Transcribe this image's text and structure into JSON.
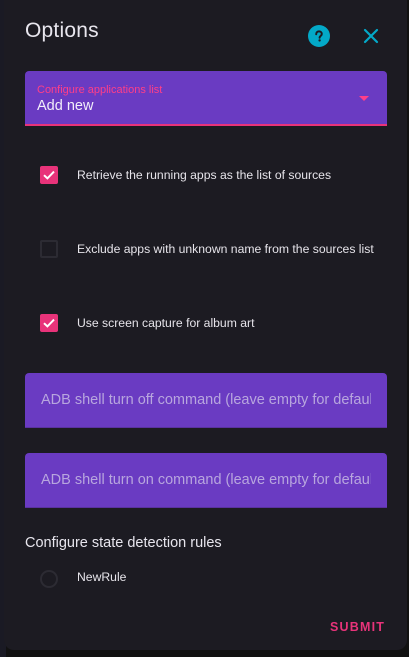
{
  "dialog": {
    "title": "Options"
  },
  "header_icons": {
    "help": "question-mark-icon",
    "close": "close-icon",
    "help_color": "#03a9c8",
    "close_color": "#03a9c8"
  },
  "select": {
    "label": "Configure applications list",
    "value": "Add new"
  },
  "checkboxes": [
    {
      "label": "Retrieve the running apps as the list of sources",
      "checked": true
    },
    {
      "label": "Exclude apps with unknown name from the sources list",
      "checked": false
    },
    {
      "label": "Use screen capture for album art",
      "checked": true
    }
  ],
  "fields": {
    "turn_off": {
      "value": "",
      "placeholder": "ADB shell turn off command (leave empty for default)"
    },
    "turn_on": {
      "value": "",
      "placeholder": "ADB shell turn on command (leave empty for default)"
    }
  },
  "rules": {
    "title": "Configure state detection rules",
    "items": [
      {
        "label": "NewRule",
        "selected": false
      }
    ]
  },
  "actions": {
    "submit_label": "SUBMIT"
  },
  "colors": {
    "accent": "#e8337a",
    "field_background": "#6a3bc2",
    "dialog_background": "#1c1b22"
  }
}
